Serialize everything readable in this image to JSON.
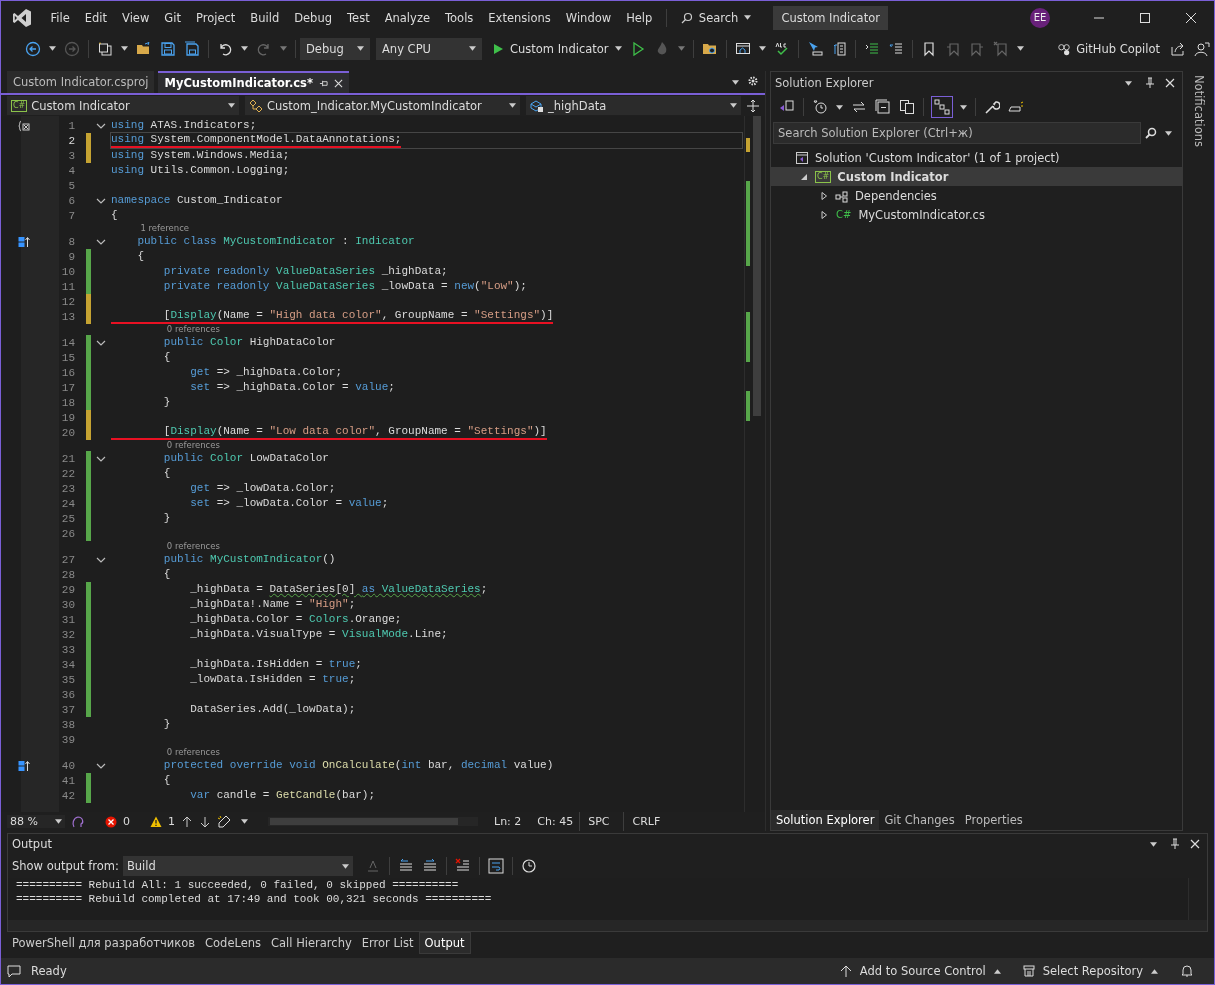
{
  "title_bar": {
    "menu": [
      "File",
      "Edit",
      "View",
      "Git",
      "Project",
      "Build",
      "Debug",
      "Test",
      "Analyze",
      "Tools",
      "Extensions",
      "Window",
      "Help"
    ],
    "search": "Search",
    "solution_name": "Custom Indicator",
    "avatar": "EE"
  },
  "toolbar": {
    "configuration": "Debug",
    "platform": "Any CPU",
    "start_target": "Custom Indicator",
    "copilot": "GitHub Copilot"
  },
  "doc_tabs": [
    {
      "label": "Custom Indicator.csproj",
      "selected": false
    },
    {
      "label": "MyCustomIndicator.cs*",
      "selected": true
    }
  ],
  "nav_bar": {
    "project_badge": "C#",
    "project": "Custom Indicator",
    "type": "Custom_Indicator.MyCustomIndicator",
    "member": "_highData"
  },
  "code": {
    "lines": [
      {
        "kind": "code",
        "num": "1",
        "gutter": {
          "kind": "braces"
        },
        "fold": true,
        "underline": false,
        "current": false,
        "tokens": [
          {
            "kind": "kw",
            "t": "using"
          },
          {
            "kind": "p",
            "t": " ATAS.Indicators;"
          }
        ]
      },
      {
        "kind": "code",
        "num": "2",
        "color": "#c5a332",
        "fold": false,
        "underline": true,
        "current": true,
        "tokens": [
          {
            "kind": "kw",
            "t": "using"
          },
          {
            "kind": "p",
            "t": " System.ComponentModel.DataAnnotations;"
          }
        ]
      },
      {
        "kind": "code",
        "num": "3",
        "color": "#c5a332",
        "fold": false,
        "underline": false,
        "current": false,
        "tokens": [
          {
            "kind": "kw",
            "t": "using"
          },
          {
            "kind": "p",
            "t": " System.Windows.Media;"
          }
        ]
      },
      {
        "kind": "code",
        "num": "4",
        "fold": false,
        "underline": false,
        "current": false,
        "tokens": [
          {
            "kind": "kw",
            "t": "using"
          },
          {
            "kind": "p",
            "t": " Utils.Common.Logging;"
          }
        ]
      },
      {
        "kind": "code",
        "num": "5",
        "fold": false,
        "current": false
      },
      {
        "kind": "code",
        "num": "6",
        "fold": true,
        "underline": false,
        "current": false,
        "tokens": [
          {
            "kind": "kw",
            "t": "namespace"
          },
          {
            "kind": "p",
            "t": " Custom_Indicator"
          }
        ]
      },
      {
        "kind": "code",
        "num": "7",
        "fold": false,
        "underline": false,
        "current": false,
        "tokens": [
          {
            "kind": "p",
            "t": "{"
          }
        ]
      },
      {
        "kind": "lens",
        "text": "1 reference"
      },
      {
        "kind": "code",
        "num": "8",
        "gutter": {
          "kind": "override"
        },
        "fold": true,
        "underline": false,
        "current": false,
        "tokens": [
          {
            "kind": "kw",
            "t": "    public class "
          },
          {
            "kind": "ty",
            "t": "MyCustomIndicator"
          },
          {
            "kind": "p",
            "t": " : "
          },
          {
            "kind": "ty",
            "t": "Indicator"
          }
        ]
      },
      {
        "kind": "code",
        "num": "9",
        "color": "#57a64a",
        "fold": false,
        "underline": false,
        "current": false,
        "tokens": [
          {
            "kind": "p",
            "t": "    {"
          }
        ]
      },
      {
        "kind": "code",
        "num": "10",
        "color": "#57a64a",
        "fold": false,
        "underline": false,
        "current": false,
        "tokens": [
          {
            "kind": "kw",
            "t": "        private readonly "
          },
          {
            "kind": "ty",
            "t": "ValueDataSeries"
          },
          {
            "kind": "p",
            "t": " _highData;"
          }
        ]
      },
      {
        "kind": "code",
        "num": "11",
        "color": "#57a64a",
        "fold": false,
        "underline": false,
        "current": false,
        "tokens": [
          {
            "kind": "kw",
            "t": "        private readonly "
          },
          {
            "kind": "ty",
            "t": "ValueDataSeries"
          },
          {
            "kind": "p",
            "t": " _lowData = "
          },
          {
            "kind": "kw",
            "t": "new"
          },
          {
            "kind": "p",
            "t": "("
          },
          {
            "kind": "st",
            "t": "\"Low\""
          },
          {
            "kind": "p",
            "t": ");"
          }
        ]
      },
      {
        "kind": "code",
        "num": "12",
        "color": "#c5a332",
        "fold": false,
        "current": false
      },
      {
        "kind": "code",
        "num": "13",
        "color": "#c5a332",
        "fold": false,
        "underline": true,
        "current": false,
        "tokens": [
          {
            "kind": "p",
            "t": "        ["
          },
          {
            "kind": "ty",
            "t": "Display"
          },
          {
            "kind": "p",
            "t": "(Name = "
          },
          {
            "kind": "st",
            "t": "\"High data color\""
          },
          {
            "kind": "p",
            "t": ", GroupName = "
          },
          {
            "kind": "st",
            "t": "\"Settings\""
          },
          {
            "kind": "p",
            "t": ")]"
          }
        ]
      },
      {
        "kind": "lens",
        "text": "0 references"
      },
      {
        "kind": "code",
        "num": "14",
        "color": "#57a64a",
        "fold": true,
        "underline": false,
        "current": false,
        "tokens": [
          {
            "kind": "kw",
            "t": "        public "
          },
          {
            "kind": "ty",
            "t": "Color"
          },
          {
            "kind": "p",
            "t": " HighDataColor"
          }
        ]
      },
      {
        "kind": "code",
        "num": "15",
        "color": "#57a64a",
        "fold": false,
        "underline": false,
        "current": false,
        "tokens": [
          {
            "kind": "p",
            "t": "        {"
          }
        ]
      },
      {
        "kind": "code",
        "num": "16",
        "color": "#57a64a",
        "fold": false,
        "underline": false,
        "current": false,
        "tokens": [
          {
            "kind": "kw",
            "t": "            get"
          },
          {
            "kind": "p",
            "t": " => _highData.Color;"
          }
        ]
      },
      {
        "kind": "code",
        "num": "17",
        "color": "#57a64a",
        "fold": false,
        "underline": false,
        "current": false,
        "tokens": [
          {
            "kind": "kw",
            "t": "            set"
          },
          {
            "kind": "p",
            "t": " => _highData.Color = "
          },
          {
            "kind": "kw",
            "t": "value"
          },
          {
            "kind": "p",
            "t": ";"
          }
        ]
      },
      {
        "kind": "code",
        "num": "18",
        "color": "#57a64a",
        "fold": false,
        "underline": false,
        "current": false,
        "tokens": [
          {
            "kind": "p",
            "t": "        }"
          }
        ]
      },
      {
        "kind": "code",
        "num": "19",
        "color": "#c5a332",
        "fold": false,
        "current": false
      },
      {
        "kind": "code",
        "num": "20",
        "color": "#c5a332",
        "fold": false,
        "underline": true,
        "current": false,
        "tokens": [
          {
            "kind": "p",
            "t": "        ["
          },
          {
            "kind": "ty",
            "t": "Display"
          },
          {
            "kind": "p",
            "t": "(Name = "
          },
          {
            "kind": "st",
            "t": "\"Low data color\""
          },
          {
            "kind": "p",
            "t": ", GroupName = "
          },
          {
            "kind": "st",
            "t": "\"Settings\""
          },
          {
            "kind": "p",
            "t": ")]"
          }
        ]
      },
      {
        "kind": "lens",
        "text": "0 references"
      },
      {
        "kind": "code",
        "num": "21",
        "color": "#57a64a",
        "fold": true,
        "underline": false,
        "current": false,
        "tokens": [
          {
            "kind": "kw",
            "t": "        public "
          },
          {
            "kind": "ty",
            "t": "Color"
          },
          {
            "kind": "p",
            "t": " LowDataColor"
          }
        ]
      },
      {
        "kind": "code",
        "num": "22",
        "color": "#57a64a",
        "fold": false,
        "underline": false,
        "current": false,
        "tokens": [
          {
            "kind": "p",
            "t": "        {"
          }
        ]
      },
      {
        "kind": "code",
        "num": "23",
        "color": "#57a64a",
        "fold": false,
        "underline": false,
        "current": false,
        "tokens": [
          {
            "kind": "kw",
            "t": "            get"
          },
          {
            "kind": "p",
            "t": " => _lowData.Color;"
          }
        ]
      },
      {
        "kind": "code",
        "num": "24",
        "color": "#57a64a",
        "fold": false,
        "underline": false,
        "current": false,
        "tokens": [
          {
            "kind": "kw",
            "t": "            set"
          },
          {
            "kind": "p",
            "t": " => _lowData.Color = "
          },
          {
            "kind": "kw",
            "t": "value"
          },
          {
            "kind": "p",
            "t": ";"
          }
        ]
      },
      {
        "kind": "code",
        "num": "25",
        "color": "#57a64a",
        "fold": false,
        "underline": false,
        "current": false,
        "tokens": [
          {
            "kind": "p",
            "t": "        }"
          }
        ]
      },
      {
        "kind": "code",
        "num": "26",
        "color": "#57a64a",
        "fold": false,
        "current": false
      },
      {
        "kind": "lens",
        "text": "0 references"
      },
      {
        "kind": "code",
        "num": "27",
        "fold": true,
        "underline": false,
        "current": false,
        "tokens": [
          {
            "kind": "kw",
            "t": "        public "
          },
          {
            "kind": "ty",
            "t": "MyCustomIndicator"
          },
          {
            "kind": "p",
            "t": "()"
          }
        ]
      },
      {
        "kind": "code",
        "num": "28",
        "fold": false,
        "underline": false,
        "current": false,
        "tokens": [
          {
            "kind": "p",
            "t": "        {"
          }
        ]
      },
      {
        "kind": "code",
        "num": "29",
        "color": "#57a64a",
        "fold": false,
        "underline": false,
        "current": false,
        "tokens": [
          {
            "kind": "p",
            "t": "            _highData = "
          },
          {
            "kind": "p",
            "t": "DataSeries[0] ",
            "squiggle": true
          },
          {
            "kind": "kw",
            "t": "as",
            "squiggle": true
          },
          {
            "kind": "ty",
            "t": " ValueDataSeries",
            "squiggle": true
          },
          {
            "kind": "p",
            "t": ";"
          }
        ]
      },
      {
        "kind": "code",
        "num": "30",
        "color": "#57a64a",
        "fold": false,
        "underline": false,
        "current": false,
        "tokens": [
          {
            "kind": "p",
            "t": "            _highData!.Name = "
          },
          {
            "kind": "st",
            "t": "\"High\""
          },
          {
            "kind": "p",
            "t": ";"
          }
        ]
      },
      {
        "kind": "code",
        "num": "31",
        "color": "#57a64a",
        "fold": false,
        "underline": false,
        "current": false,
        "tokens": [
          {
            "kind": "p",
            "t": "            _highData.Color = "
          },
          {
            "kind": "ty",
            "t": "Colors"
          },
          {
            "kind": "p",
            "t": ".Orange;"
          }
        ]
      },
      {
        "kind": "code",
        "num": "32",
        "color": "#57a64a",
        "fold": false,
        "underline": false,
        "current": false,
        "tokens": [
          {
            "kind": "p",
            "t": "            _highData.VisualType = "
          },
          {
            "kind": "ty",
            "t": "VisualMode"
          },
          {
            "kind": "p",
            "t": ".Line;"
          }
        ]
      },
      {
        "kind": "code",
        "num": "33",
        "color": "#57a64a",
        "fold": false,
        "current": false
      },
      {
        "kind": "code",
        "num": "34",
        "color": "#57a64a",
        "fold": false,
        "underline": false,
        "current": false,
        "tokens": [
          {
            "kind": "p",
            "t": "            _highData.IsHidden = "
          },
          {
            "kind": "kw",
            "t": "true"
          },
          {
            "kind": "p",
            "t": ";"
          }
        ]
      },
      {
        "kind": "code",
        "num": "35",
        "color": "#57a64a",
        "fold": false,
        "underline": false,
        "current": false,
        "tokens": [
          {
            "kind": "p",
            "t": "            _lowData.IsHidden = "
          },
          {
            "kind": "kw",
            "t": "true"
          },
          {
            "kind": "p",
            "t": ";"
          }
        ]
      },
      {
        "kind": "code",
        "num": "36",
        "color": "#57a64a",
        "fold": false,
        "current": false
      },
      {
        "kind": "code",
        "num": "37",
        "color": "#57a64a",
        "fold": false,
        "underline": false,
        "current": false,
        "tokens": [
          {
            "kind": "p",
            "t": "            DataSeries.Add(_lowData);"
          }
        ]
      },
      {
        "kind": "code",
        "num": "38",
        "fold": false,
        "underline": false,
        "current": false,
        "tokens": [
          {
            "kind": "p",
            "t": "        }"
          }
        ]
      },
      {
        "kind": "code",
        "num": "39",
        "fold": false,
        "current": false
      },
      {
        "kind": "lens",
        "text": "0 references"
      },
      {
        "kind": "code",
        "num": "40",
        "gutter": {
          "kind": "override"
        },
        "fold": true,
        "underline": false,
        "current": false,
        "tokens": [
          {
            "kind": "kw",
            "t": "        protected override void "
          },
          {
            "kind": "fn",
            "t": "OnCalculate"
          },
          {
            "kind": "p",
            "t": "("
          },
          {
            "kind": "kw",
            "t": "int"
          },
          {
            "kind": "p",
            "t": " bar, "
          },
          {
            "kind": "kw",
            "t": "decimal"
          },
          {
            "kind": "p",
            "t": " value)"
          }
        ]
      },
      {
        "kind": "code",
        "num": "41",
        "color": "#57a64a",
        "fold": false,
        "underline": false,
        "current": false,
        "tokens": [
          {
            "kind": "p",
            "t": "        {"
          }
        ]
      },
      {
        "kind": "code",
        "num": "42",
        "color": "#57a64a",
        "fold": false,
        "underline": false,
        "current": false,
        "tokens": [
          {
            "kind": "kw",
            "t": "            var"
          },
          {
            "kind": "p",
            "t": " candle = "
          },
          {
            "kind": "fn",
            "t": "GetCandle"
          },
          {
            "kind": "p",
            "t": "(bar);"
          }
        ]
      }
    ]
  },
  "editor_status": {
    "zoom": "88 %",
    "errors": "0",
    "warnings": "1",
    "line": "Ln: 2",
    "column": "Ch: 45",
    "indent": "SPC",
    "line_ending": "CRLF"
  },
  "solution_explorer": {
    "title": "Solution Explorer",
    "search": {
      "placeholder": "Search Solution Explorer (Ctrl+ж)"
    },
    "tree": [
      {
        "label": "Solution 'Custom Indicator' (1 of 1 project)",
        "kind": "solution",
        "selected": false,
        "children": [
          {
            "label": "Custom Indicator",
            "kind": "project",
            "badge": "C#",
            "selected": true,
            "expanded": true,
            "children": [
              {
                "label": "Dependencies",
                "kind": "dependencies",
                "selected": false,
                "expanded": false
              },
              {
                "label": "MyCustomIndicator.cs",
                "kind": "csfile",
                "badge": "C#",
                "selected": false,
                "expanded": false
              }
            ]
          }
        ]
      }
    ],
    "tabs": [
      {
        "label": "Solution Explorer",
        "selected": true
      },
      {
        "label": "Git Changes",
        "selected": false
      },
      {
        "label": "Properties",
        "selected": false
      }
    ]
  },
  "notifications": "Notifications",
  "output": {
    "title": "Output",
    "source_label": "Show output from:",
    "source": "Build",
    "lines": [
      "========== Rebuild All: 1 succeeded, 0 failed, 0 skipped ==========",
      "========== Rebuild completed at 17:49 and took 00,321 seconds =========="
    ]
  },
  "tool_tabs": [
    {
      "label": "PowerShell для разработчиков",
      "selected": false
    },
    {
      "label": "CodeLens",
      "selected": false
    },
    {
      "label": "Call Hierarchy",
      "selected": false
    },
    {
      "label": "Error List",
      "selected": false
    },
    {
      "label": "Output",
      "selected": true
    }
  ],
  "status_bar": {
    "state": "Ready",
    "source_control": "Add to Source Control",
    "repository": "Select Repository"
  }
}
